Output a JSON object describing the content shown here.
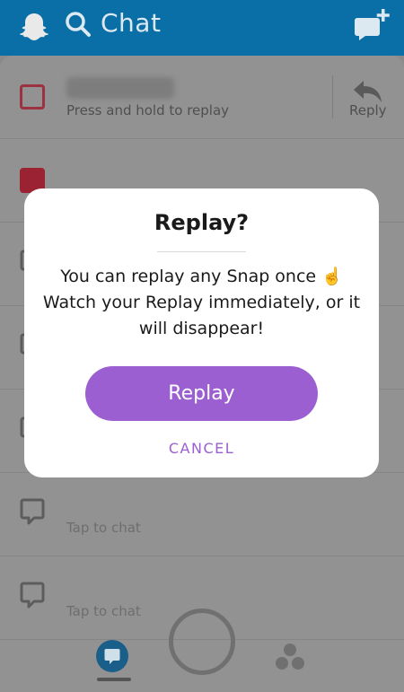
{
  "header": {
    "title": "Chat",
    "icons": [
      "ghost-icon",
      "search-icon",
      "new-chat-icon"
    ],
    "background": "#0a6fa6"
  },
  "list": {
    "rows": [
      {
        "state": "unread",
        "subtitle": "Press and hold to replay",
        "action_label": "Reply"
      },
      {
        "state": "new-snap"
      },
      {
        "state": "chat"
      },
      {
        "state": "chat"
      },
      {
        "state": "chat"
      },
      {
        "state": "chat",
        "subtitle": "Tap to chat"
      },
      {
        "state": "chat",
        "subtitle": "Tap to chat"
      }
    ]
  },
  "modal": {
    "title": "Replay?",
    "body": "You can replay any Snap once ☝️ Watch your Replay immediately, or it will disappear!",
    "primary_label": "Replay",
    "cancel_label": "CANCEL",
    "accent": "#9b5fd1"
  },
  "bottom_nav": {
    "items": [
      "chat-icon",
      "capture-button",
      "friends-icon"
    ]
  }
}
